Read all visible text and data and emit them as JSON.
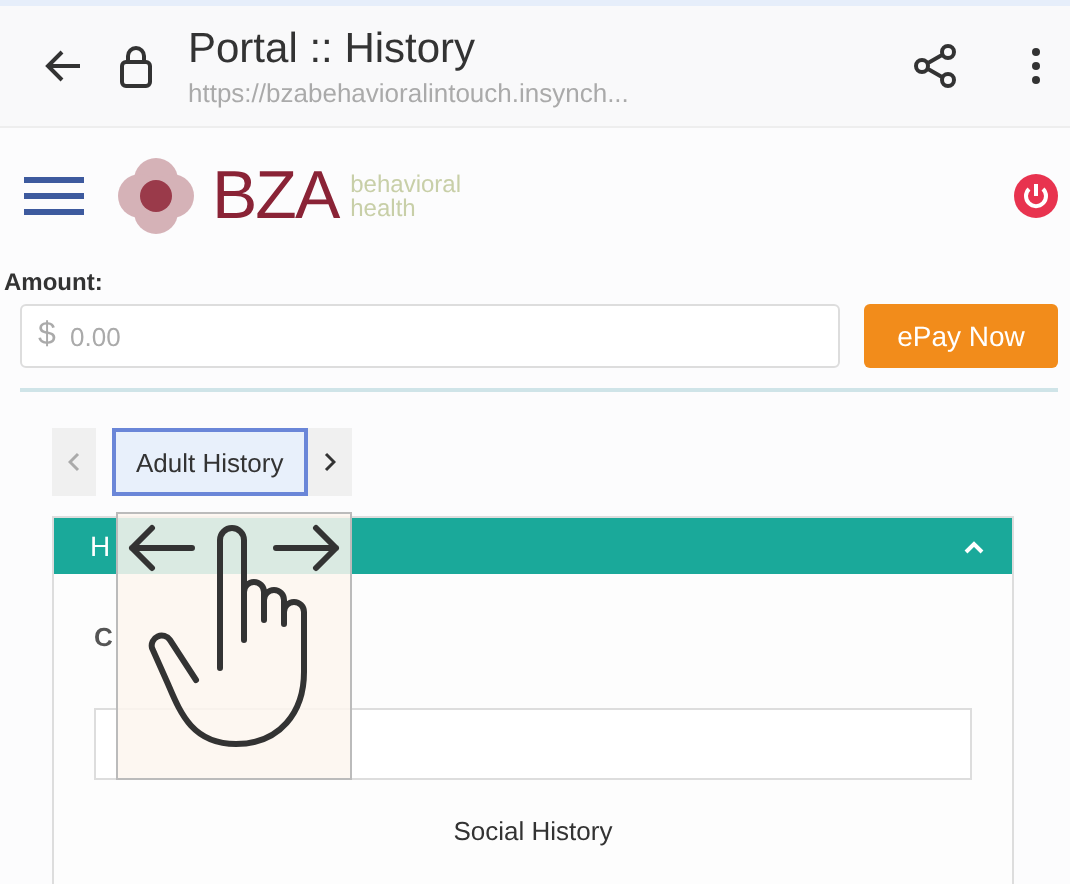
{
  "browser": {
    "title": "Portal :: History",
    "url": "https://bzabehavioralintouch.insynch..."
  },
  "header": {
    "logo_mark": "BZA",
    "logo_text": [
      "behavioral",
      "health"
    ]
  },
  "payment": {
    "label": "Amount:",
    "currency": "$",
    "placeholder": "0.00",
    "button": "ePay Now"
  },
  "tabs": [
    {
      "label": "Adult History",
      "selected": true
    }
  ],
  "panel": {
    "title": "H",
    "expanded": true,
    "field_label": "C",
    "section": "Social History"
  }
}
